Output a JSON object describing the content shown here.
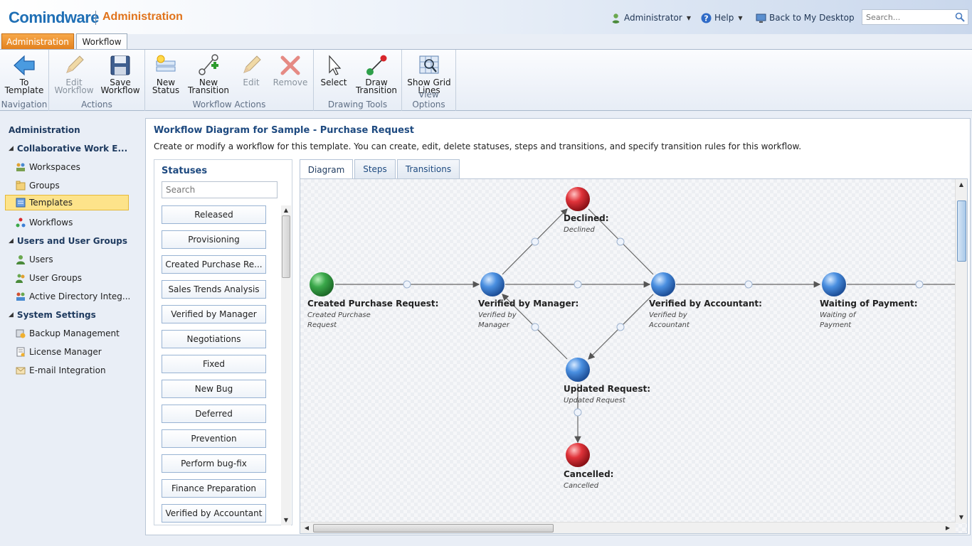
{
  "header": {
    "logo": "Comindware",
    "title": "Administration",
    "user_label": "Administrator",
    "help_label": "Help",
    "desktop_label": "Back to My Desktop",
    "search_placeholder": "Search..."
  },
  "ribbon_tabs": [
    "Administration",
    "Workflow"
  ],
  "ribbon": {
    "groups": [
      {
        "label": "Navigation",
        "buttons": [
          {
            "label": "To Template",
            "icon": "back-arrow-icon",
            "enabled": true
          }
        ]
      },
      {
        "label": "Actions",
        "buttons": [
          {
            "label": "Edit Workflow",
            "icon": "pencil-icon",
            "enabled": false
          },
          {
            "label": "Save Workflow",
            "icon": "floppy-disk-icon",
            "enabled": true
          }
        ]
      },
      {
        "label": "Workflow Actions",
        "buttons": [
          {
            "label": "New Status",
            "icon": "new-status-icon",
            "enabled": true
          },
          {
            "label": "New Transition",
            "icon": "new-transition-icon",
            "enabled": true
          },
          {
            "label": "Edit",
            "icon": "pencil-icon",
            "enabled": false
          },
          {
            "label": "Remove",
            "icon": "red-x-icon",
            "enabled": false
          }
        ]
      },
      {
        "label": "Drawing Tools",
        "buttons": [
          {
            "label": "Select",
            "icon": "cursor-icon",
            "enabled": true
          },
          {
            "label": "Draw Transition",
            "icon": "draw-transition-icon",
            "enabled": true
          }
        ]
      },
      {
        "label": "View Options",
        "buttons": [
          {
            "label": "Show Grid Lines",
            "icon": "grid-lines-icon",
            "enabled": true
          }
        ]
      }
    ]
  },
  "nav": {
    "root": "Administration",
    "sections": [
      {
        "title": "Collaborative Work E...",
        "items": [
          {
            "label": "Workspaces",
            "icon": "workspaces-icon"
          },
          {
            "label": "Groups",
            "icon": "groups-icon"
          },
          {
            "label": "Templates",
            "icon": "templates-icon",
            "selected": true
          },
          {
            "label": "Workflows",
            "icon": "workflows-icon"
          }
        ]
      },
      {
        "title": "Users and User Groups",
        "items": [
          {
            "label": "Users",
            "icon": "user-icon"
          },
          {
            "label": "User Groups",
            "icon": "user-groups-icon"
          },
          {
            "label": "Active Directory Integ...",
            "icon": "active-directory-icon"
          }
        ]
      },
      {
        "title": "System Settings",
        "items": [
          {
            "label": "Backup Management",
            "icon": "backup-icon"
          },
          {
            "label": "License Manager",
            "icon": "license-icon"
          },
          {
            "label": "E-mail Integration",
            "icon": "email-icon"
          }
        ]
      }
    ]
  },
  "main": {
    "title": "Workflow Diagram for Sample - Purchase Request",
    "description": "Create or modify a workflow for this template. You can create, edit, delete statuses, steps and transitions, and specify transition rules for this workflow."
  },
  "statuses": {
    "title": "Statuses",
    "search_placeholder": "Search",
    "items": [
      "Released",
      "Provisioning",
      "Created Purchase Re...",
      "Sales Trends Analysis",
      "Verified by Manager",
      "Negotiations",
      "Fixed",
      "New Bug",
      "Deferred",
      "Prevention",
      "Perform bug-fix",
      "Finance Preparation",
      "Verified by Accountant"
    ]
  },
  "diagram_tabs": [
    "Diagram",
    "Steps",
    "Transitions"
  ],
  "diagram": {
    "nodes": [
      {
        "id": "created",
        "label": "Created Purchase Request:",
        "sub": "Created Purchase Request",
        "color": "#3aa84a"
      },
      {
        "id": "manager",
        "label": "Verified by Manager:",
        "sub": "Verified by Manager",
        "color": "#3b7fd6"
      },
      {
        "id": "accountant",
        "label": "Verified by Accountant:",
        "sub": "Verified by Accountant",
        "color": "#3b7fd6"
      },
      {
        "id": "payment",
        "label": "Waiting of Payment:",
        "sub": "Waiting of Payment",
        "color": "#3b7fd6"
      },
      {
        "id": "declined",
        "label": "Declined:",
        "sub": "Declined",
        "color": "#d8262b"
      },
      {
        "id": "updated",
        "label": "Updated Request:",
        "sub": "Updated Request",
        "color": "#3b7fd6"
      },
      {
        "id": "cancelled",
        "label": "Cancelled:",
        "sub": "Cancelled",
        "color": "#d8262b"
      }
    ]
  }
}
